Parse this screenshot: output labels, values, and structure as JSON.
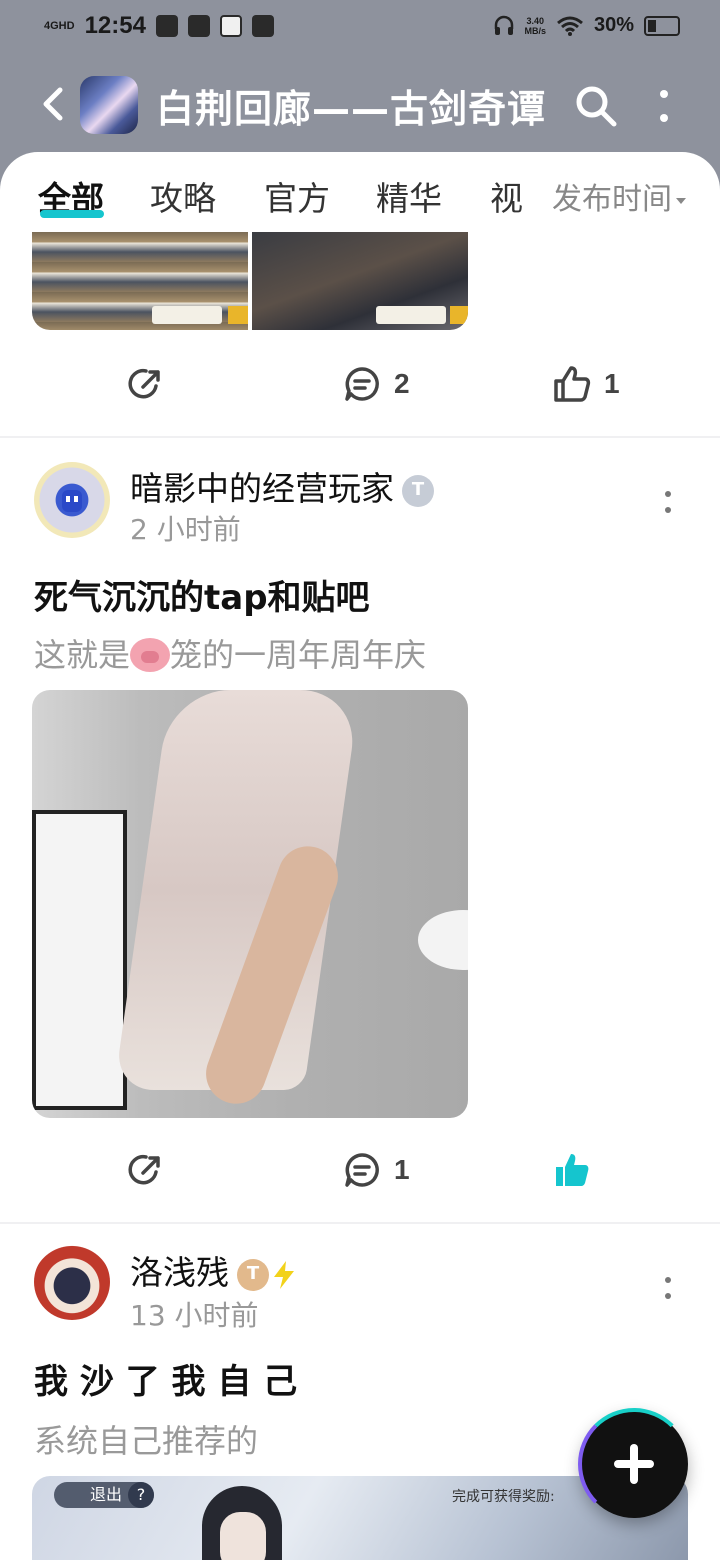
{
  "status_bar": {
    "network": "4GHD",
    "time": "12:54",
    "speed_value": "3.40",
    "speed_unit": "MB/s",
    "battery": "30%",
    "battery_level": 0.3
  },
  "header": {
    "title": "白荆回廊——古剑奇谭"
  },
  "tabs": [
    "全部",
    "攻略",
    "官方",
    "精华",
    "视"
  ],
  "sort_label": "发布时间",
  "post0": {
    "comments": "2",
    "likes": "1"
  },
  "post1": {
    "username": "暗影中的经营玩家",
    "badge": "T",
    "time": "2 小时前",
    "title": "死气沉沉的tap和贴吧",
    "body_before": "这就是",
    "body_after": "笼的一周年周年庆",
    "comments": "1",
    "liked": true
  },
  "post2": {
    "username": "洛浅残",
    "badge": "T",
    "time": "13 小时前",
    "title": "我 沙 了 我 自 己",
    "body": "系统自己推荐的",
    "game_exit": "退出",
    "game_help": "?",
    "game_reward": "完成可获得奖励:"
  },
  "colors": {
    "accent": "#15c5ce",
    "header_bg": "#8e929d",
    "liked": "#15c5ce"
  }
}
